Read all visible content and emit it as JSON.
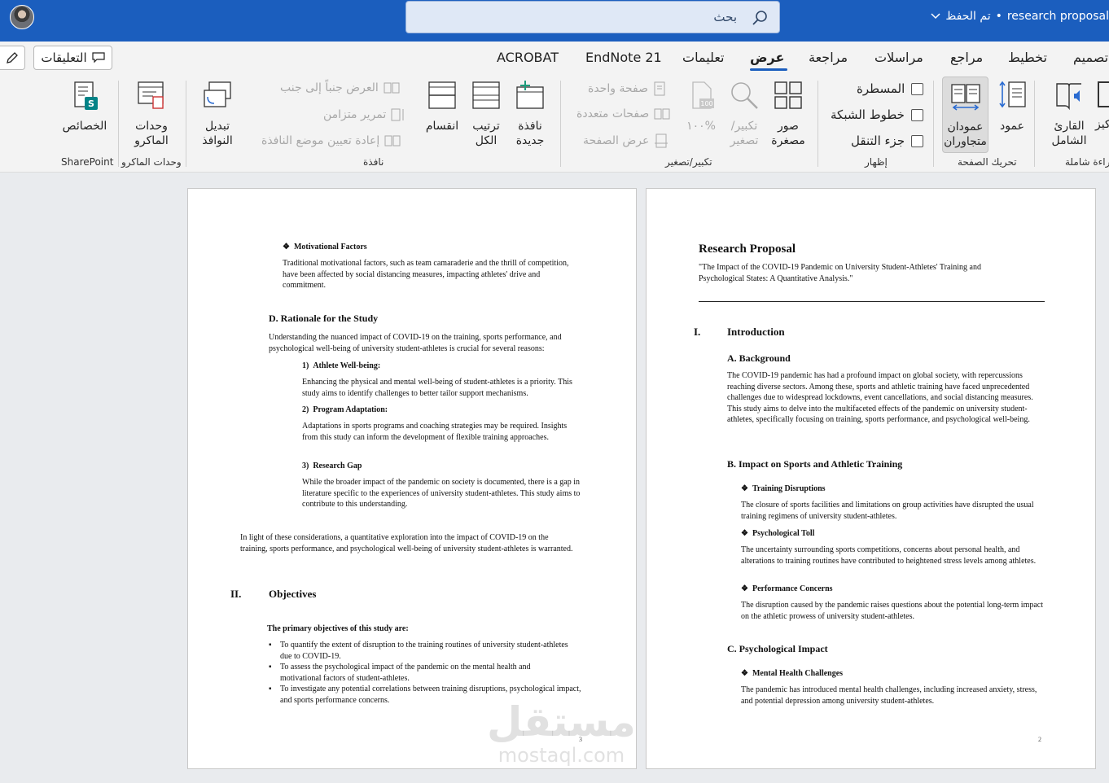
{
  "titlebar": {
    "doc_title": "research proposal",
    "save_status": "تم الحفظ",
    "search_label": "بحث"
  },
  "tabs": [
    {
      "label": "تصميم"
    },
    {
      "label": "تخطيط"
    },
    {
      "label": "مراجع"
    },
    {
      "label": "مراسلات"
    },
    {
      "label": "مراجعة"
    },
    {
      "label": "عرض"
    },
    {
      "label": "تعليمات"
    },
    {
      "label": "EndNote 21"
    },
    {
      "label": "ACROBAT"
    }
  ],
  "comments_label": "التعليقات",
  "ribbon": {
    "immersive": {
      "reader": "القارئ الشامل",
      "focus": "تركيز",
      "group": "قراءة شاملة"
    },
    "page_movement": {
      "vertical": "عمود",
      "side_by_side": "عمودان متجاوران",
      "group": "تحريك الصفحة"
    },
    "show": {
      "ruler": "المسطرة",
      "gridlines": "خطوط الشبكة",
      "nav_pane": "جزء التنقل",
      "group": "إظهار"
    },
    "zoom": {
      "thumbnails": "صور مصغرة",
      "zoom": "تكبير/تصغير",
      "percent": "١٠٠%",
      "one_page": "صفحة واحدة",
      "multi_page": "صفحات متعددة",
      "page_width": "عرض الصفحة",
      "group": "تكبير/تصغير"
    },
    "window": {
      "new_window": "نافذة جديدة",
      "arrange_all": "ترتيب الكل",
      "split": "انقسام",
      "side_by_side": "العرض جنباً إلى جنب",
      "sync_scroll": "تمرير متزامن",
      "reset_pos": "إعادة تعيين موضع النافذة",
      "switch_windows": "تبديل النوافذ",
      "group": "نافذة"
    },
    "macros": {
      "label": "وحدات الماكرو",
      "group": "وحدات الماكرو"
    },
    "sharepoint": {
      "label": "الخصائص",
      "group": "SharePoint"
    }
  },
  "page_right": {
    "title": "Research Proposal",
    "subtitle": "\"The Impact of the COVID-19 Pandemic on University Student-Athletes' Training and Psychological States: A Quantitative Analysis.\"",
    "sec1_num": "I.",
    "sec1_title": "Introduction",
    "a_title": "A. Background",
    "a_body": "The COVID-19 pandemic has had a profound impact on global society, with repercussions reaching diverse sectors. Among these, sports and athletic training have faced unprecedented challenges due to widespread lockdowns, event cancellations, and social distancing measures. This study aims to delve into the multifaceted effects of the pandemic on university student-athletes, specifically focusing on training, sports performance, and psychological well-being.",
    "b_title": "B. Impact on Sports and Athletic Training",
    "b1_title": "Training Disruptions",
    "b1_body": "The closure of sports facilities and limitations on group activities have disrupted the usual training regimens of university student-athletes.",
    "b2_title": "Psychological Toll",
    "b2_body": "The uncertainty surrounding sports competitions, concerns about personal health, and alterations to training routines have contributed to heightened stress levels among athletes.",
    "b3_title": "Performance Concerns",
    "b3_body": "The disruption caused by the pandemic raises questions about the potential long-term impact on the athletic prowess of university student-athletes.",
    "c_title": "C. Psychological Impact",
    "c1_title": "Mental Health Challenges",
    "c1_body": "The pandemic has introduced mental health challenges, including increased anxiety, stress, and potential depression among university student-athletes.",
    "page_num": "2"
  },
  "page_left": {
    "mf_title": "Motivational Factors",
    "mf_body": "Traditional motivational factors, such as team camaraderie and the thrill of competition, have been affected by social distancing measures, impacting athletes' drive and commitment.",
    "d_title": "D. Rationale for the Study",
    "d_body": "Understanding the nuanced impact of COVID-19 on the training, sports performance, and psychological well-being of university student-athletes is crucial for several reasons:",
    "r1_title": "1) Athlete Well-being:",
    "r1_body": "Enhancing the physical and mental well-being of student-athletes is a priority. This study aims to identify challenges to better tailor support mechanisms.",
    "r2_title": "2) Program Adaptation:",
    "r2_body": "Adaptations in sports programs and coaching strategies may be required. Insights from this study can inform the development of flexible training approaches.",
    "r3_title": "3) Research Gap",
    "r3_body": "While the broader impact of the pandemic on society is documented, there is a gap in literature specific to the experiences of university student-athletes. This study aims to contribute to this understanding.",
    "conclusion": "In light of these considerations, a quantitative exploration into the impact of COVID-19 on the training, sports performance, and psychological well-being of university student-athletes is warranted.",
    "sec2_num": "II.",
    "sec2_title": "Objectives",
    "obj_intro": "The primary objectives of this study are:",
    "objectives": [
      "To quantify the extent of disruption to the training routines of university student-athletes due to COVID-19.",
      "To assess the psychological impact of the pandemic on the mental health and motivational factors of student-athletes.",
      "To investigate any potential correlations between training disruptions, psychological impact, and sports performance concerns."
    ],
    "page_num": "3"
  },
  "watermark": {
    "arabic": "مستقل",
    "latin": "mostaql.com"
  }
}
